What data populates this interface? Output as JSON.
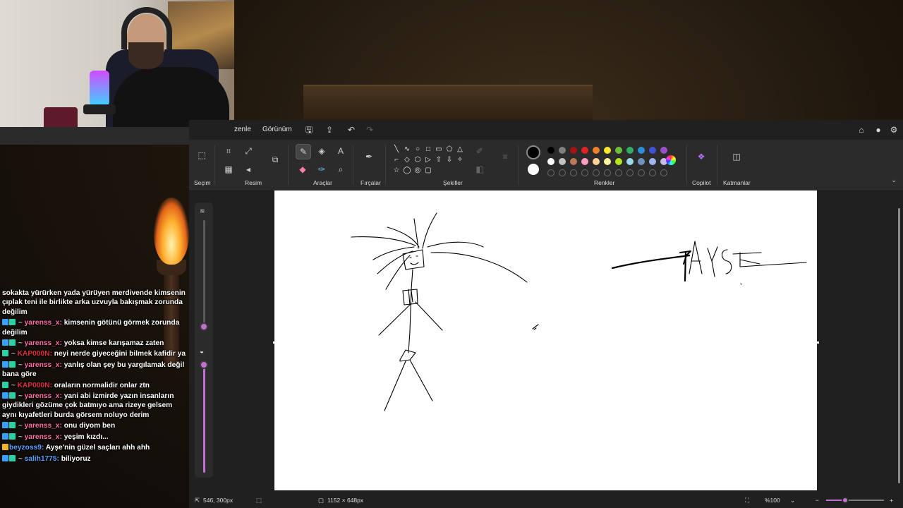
{
  "menu": {
    "items": [
      "zenle",
      "Görünüm"
    ]
  },
  "ribbon": {
    "groups": {
      "selection": "Seçim",
      "image": "Resim",
      "tools": "Araçlar",
      "brushes": "Fırçalar",
      "shapes": "Şekiller",
      "colors": "Renkler",
      "copilot": "Copilot",
      "layers": "Katmanlar"
    },
    "shape_glyphs": [
      "╲",
      "∿",
      "○",
      "□",
      "▭",
      "⬠",
      "△",
      "⌐",
      "◇",
      "⬡",
      "▷",
      "⇧",
      "⇩",
      "✧",
      "☆",
      "◯",
      "◎",
      "▢"
    ],
    "colors_row1": [
      "#000000",
      "#7f7f7f",
      "#a31515",
      "#e02424",
      "#f07f2a",
      "#f5e82b",
      "#6abf3b",
      "#2fae61",
      "#2b8fd8",
      "#3f51d9",
      "#9b4fc7"
    ],
    "colors_row2": [
      "#ffffff",
      "#c3c3c3",
      "#b97a57",
      "#ff9ec2",
      "#ffd29a",
      "#fff5a0",
      "#b5e61d",
      "#99d9ea",
      "#7092be",
      "#a2b4ea",
      "#c8bfe7"
    ],
    "primary_color": "#000000",
    "secondary_color": "#ffffff"
  },
  "status": {
    "cursor_position": "546, 300px",
    "canvas_size": "1152 × 648px",
    "zoom": "%100",
    "zoom_level": 0.33
  },
  "chat": {
    "messages": [
      {
        "user": "",
        "user_color": "#3aa0ff",
        "badges": "",
        "text": "sokakta yürürken yada yürüyen merdivende kimsenin çıplak teni ile birlikte arka uzvuyla bakışmak zorunda değilim"
      },
      {
        "user": "yarenss_x:",
        "user_color": "#ff6fa8",
        "badges": "sub",
        "text": "kimsenin götünü görmek zorunda değilim"
      },
      {
        "user": "yarenss_x:",
        "user_color": "#ff6fa8",
        "badges": "sub",
        "text": "yoksa kimse karışamaz zaten"
      },
      {
        "user": "KAP000N:",
        "user_color": "#e0303a",
        "badges": "single",
        "text": "neyi nerde giyeceğini bilmek kafidir ya"
      },
      {
        "user": "yarenss_x:",
        "user_color": "#ff6fa8",
        "badges": "sub",
        "text": "yanlış olan şey bu yargılamak değil bana göre"
      },
      {
        "user": "KAP000N:",
        "user_color": "#e0303a",
        "badges": "single",
        "text": "oraların normalidir onlar ztn"
      },
      {
        "user": "yarenss_x:",
        "user_color": "#ff6fa8",
        "badges": "sub",
        "text": "yani abi izmirde yazın insanların giydikleri gözüme çok batmıyo ama rizeye gelsem aynı kıyafetleri burda görsem noluyo derim"
      },
      {
        "user": "yarenss_x:",
        "user_color": "#ff6fa8",
        "badges": "sub",
        "text": "onu diyom ben"
      },
      {
        "user": "yarenss_x:",
        "user_color": "#ff6fa8",
        "badges": "sub",
        "text": "yeşim kızdı..."
      },
      {
        "user": "beyzoss9:",
        "user_color": "#5aa0ff",
        "badges": "gold",
        "text": "Ayşe'nin güzel saçları ahh ahh"
      },
      {
        "user": "salih1775:",
        "user_color": "#5aa0ff",
        "badges": "sub",
        "text": "biliyoruz"
      }
    ]
  }
}
